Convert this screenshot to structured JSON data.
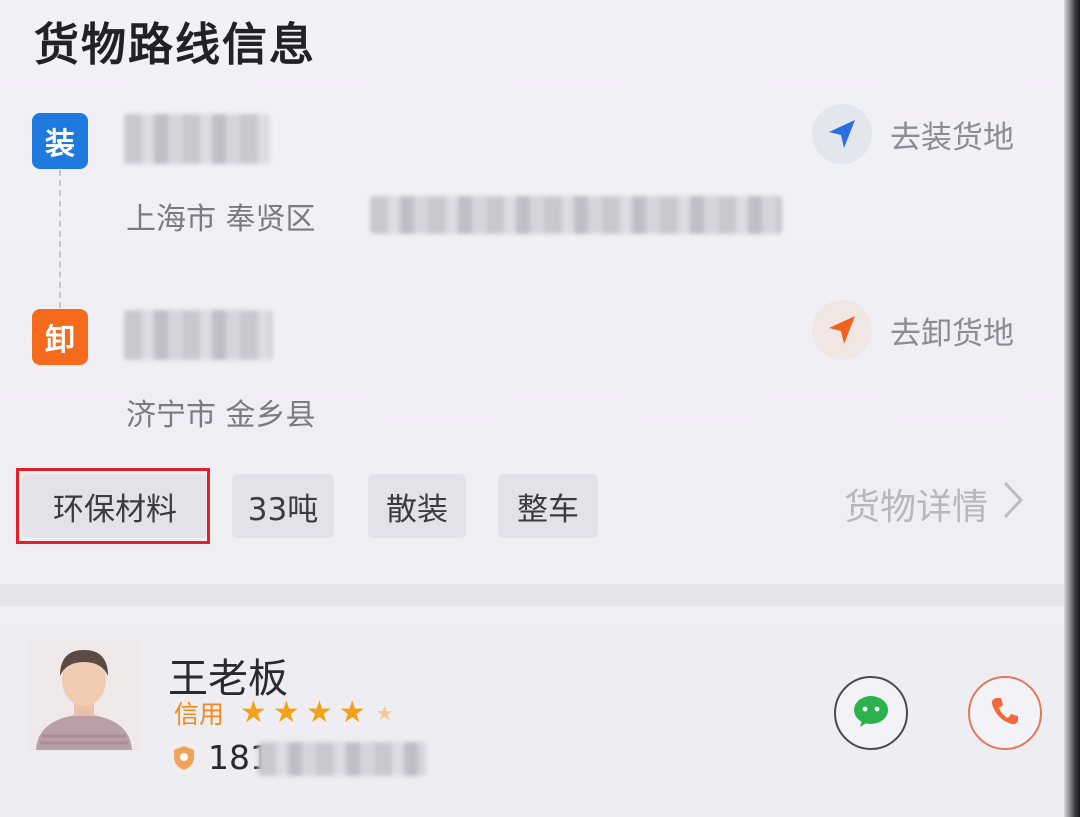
{
  "header": {
    "title": "货物路线信息"
  },
  "route": {
    "load": {
      "badge": "装",
      "address": "上海市 奉贤区",
      "nav_label": "去装货地"
    },
    "unload": {
      "badge": "卸",
      "address": "济宁市 金乡县",
      "nav_label": "去卸货地"
    }
  },
  "tags": [
    {
      "label": "环保材料"
    },
    {
      "label": "33吨"
    },
    {
      "label": "散装"
    },
    {
      "label": "整车"
    }
  ],
  "detail_link": "货物详情",
  "owner": {
    "name": "王老板",
    "credit_label": "信用",
    "stars": 4,
    "phone_prefix": "181"
  },
  "colors": {
    "load_badge": "#1f7ae0",
    "unload_badge": "#f56a1c",
    "highlight": "#e3202a",
    "star": "#f4a11a",
    "wechat": "#2bb24c",
    "call": "#f26a3b"
  },
  "icons": [
    "navigate-arrow-icon",
    "chevron-right-icon",
    "wechat-icon",
    "phone-icon",
    "shield-icon",
    "star-icon"
  ]
}
